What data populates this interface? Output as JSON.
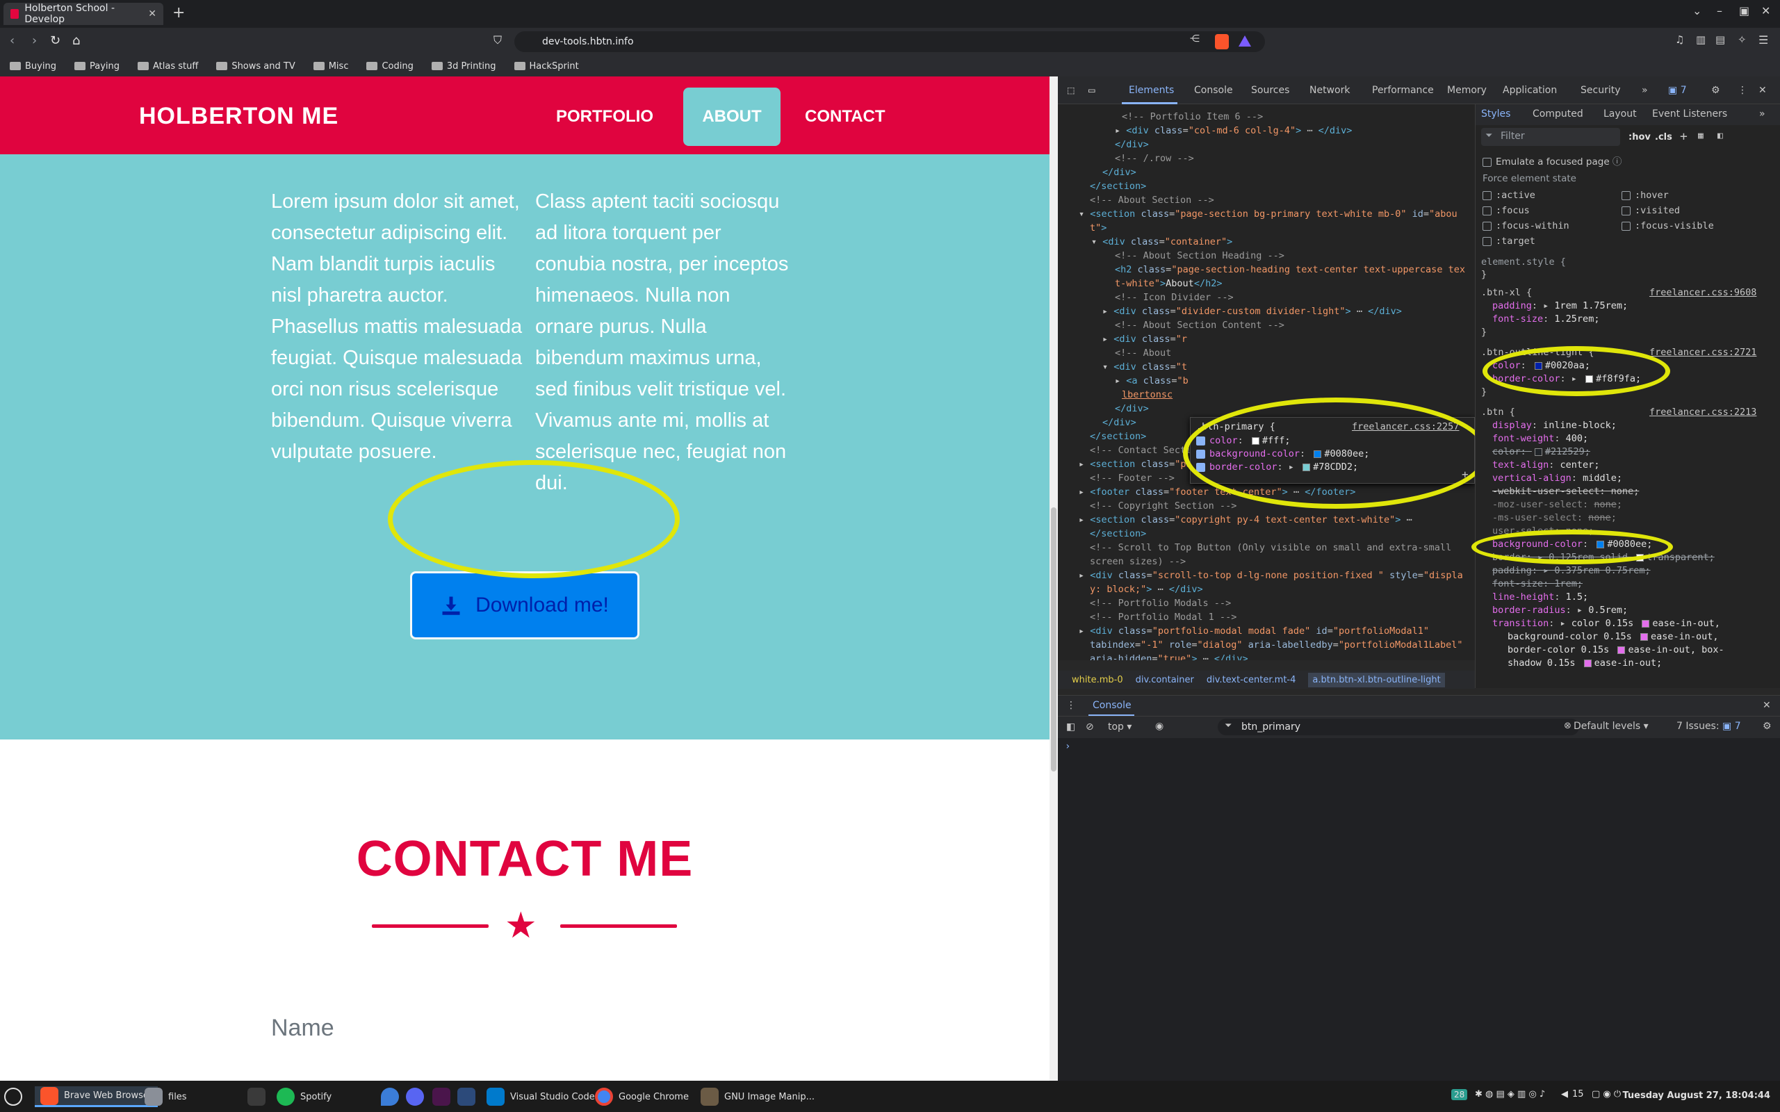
{
  "browser": {
    "tab_title": "Holberton School - Develop",
    "url": "dev-tools.hbtn.info",
    "bookmarks": [
      "Buying",
      "Paying",
      "Atlas stuff",
      "Shows and TV",
      "Misc",
      "Coding",
      "3d Printing",
      "HackSprint"
    ]
  },
  "site": {
    "brand": "HOLBERTON ME",
    "nav": [
      "PORTFOLIO",
      "ABOUT",
      "CONTACT"
    ],
    "about_left": "Lorem ipsum dolor sit amet, consectetur adipiscing elit. Nam blandit turpis iaculis nisl pharetra auctor. Phasellus mattis malesuada feugiat. Quisque malesuada orci non risus scelerisque bibendum. Quisque viverra vulputate posuere.",
    "about_right": "Class aptent taciti sociosqu ad litora torquent per conubia nostra, per inceptos himenaeos. Nulla non ornare purus. Nulla bibendum maximus urna, sed finibus velit tristique vel. Vivamus ante mi, mollis at scelerisque nec, feugiat non dui.",
    "download_label": "Download me!",
    "contact_heading": "CONTACT ME",
    "name_label": "Name"
  },
  "devtools": {
    "tabs": [
      "Elements",
      "Console",
      "Sources",
      "Network",
      "Performance",
      "Memory",
      "Application",
      "Security"
    ],
    "issues_count": "7",
    "breadcrumbs": [
      "white.mb-0",
      "div.container",
      "div.text-center.mt-4",
      "a.btn.btn-xl.btn-outline-light"
    ],
    "style_tabs": [
      "Styles",
      "Computed",
      "Layout",
      "Event Listeners"
    ],
    "filter_placeholder": "Filter",
    "hov": ":hov",
    "cls": ".cls",
    "emulate_focus": "Emulate a focused page",
    "force_state": "Force element state",
    "states": [
      ":active",
      ":hover",
      ":focus",
      ":visited",
      ":focus-within",
      ":focus-visible",
      ":target"
    ],
    "console_title": "Console",
    "console_context": "top",
    "console_filter": "btn_primary",
    "console_levels": "Default levels",
    "console_issues": "7 Issues:",
    "console_issues_count": "7"
  },
  "taskbar": {
    "apps": [
      "Brave Web Browser",
      "files",
      "Spotify",
      "Visual Studio Code",
      "Google Chrome",
      "GNU Image Manip..."
    ],
    "clock": "Tuesday August 27, 18:04:44",
    "tray_num": "15",
    "tray_badge": "28"
  },
  "colors": {
    "brand_red": "#e0043f",
    "teal": "#78cdd2",
    "btn_blue": "#0080ee",
    "btn_text": "#0020aa",
    "highlight": "#e0e60a"
  }
}
